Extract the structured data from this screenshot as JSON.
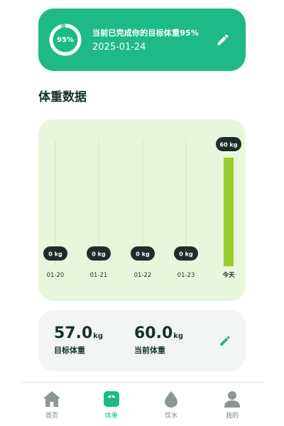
{
  "goal": {
    "progress_label": "95%",
    "progress_value": 0.95,
    "message": "当前已完成你的目标体重95%",
    "date": "2025-01-24",
    "edit_icon": "pencil-icon"
  },
  "section_title": "体重数据",
  "chart_data": {
    "type": "bar",
    "categories": [
      "01-20",
      "01-21",
      "01-22",
      "01-23",
      "今天"
    ],
    "values": [
      0,
      0,
      0,
      0,
      60
    ],
    "value_labels": [
      "0 kg",
      "0 kg",
      "0 kg",
      "0 kg",
      "60 kg"
    ],
    "unit": "kg",
    "ylim": [
      0,
      60
    ],
    "bar_color": "#9acd32",
    "grid": false
  },
  "stats": {
    "target_value": "57.0",
    "target_unit": "kg",
    "target_label": "目标体重",
    "current_value": "60.0",
    "current_unit": "kg",
    "current_label": "当前体重",
    "edit_icon": "pencil-icon"
  },
  "nav": {
    "items": [
      {
        "label": "首页",
        "icon": "home-icon"
      },
      {
        "label": "体重",
        "icon": "scale-icon",
        "active": true
      },
      {
        "label": "饮水",
        "icon": "water-drop-icon"
      },
      {
        "label": "我的",
        "icon": "user-icon"
      }
    ]
  },
  "colors": {
    "accent": "#1dba88",
    "chart_bg": "#eaf6dc",
    "bar": "#9acd32",
    "pill": "#1f2d2a"
  }
}
